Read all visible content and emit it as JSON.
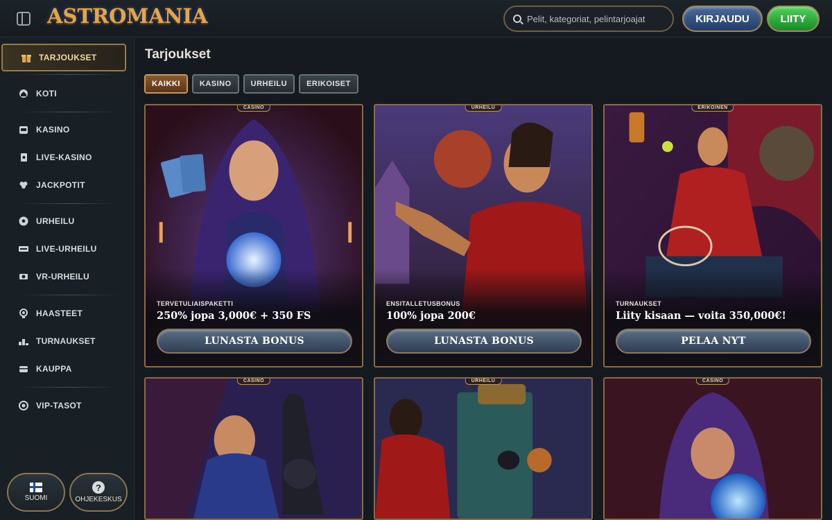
{
  "header": {
    "logo_text": "ASTROMANIA",
    "search_placeholder": "Pelit, kategoriat, pelintarjoajat",
    "login_label": "KIRJAUDU",
    "join_label": "LIITY"
  },
  "sidebar": {
    "items": [
      {
        "label": "TARJOUKSET",
        "icon": "gift-icon"
      },
      {
        "label": "KOTI",
        "icon": "home-icon"
      },
      {
        "label": "KASINO",
        "icon": "slot-machine-icon"
      },
      {
        "label": "LIVE-KASINO",
        "icon": "playing-card-icon"
      },
      {
        "label": "JACKPOTIT",
        "icon": "clover-icon"
      },
      {
        "label": "URHEILU",
        "icon": "soccer-ball-icon"
      },
      {
        "label": "LIVE-URHEILU",
        "icon": "live-badge-icon"
      },
      {
        "label": "VR-URHEILU",
        "icon": "vr-icon"
      },
      {
        "label": "HAASTEET",
        "icon": "medal-icon"
      },
      {
        "label": "TURNAUKSET",
        "icon": "podium-icon"
      },
      {
        "label": "KAUPPA",
        "icon": "chest-icon"
      },
      {
        "label": "VIP-TASOT",
        "icon": "vip-icon"
      }
    ],
    "language_label": "SUOMI",
    "help_label": "OHJEKESKUS",
    "help_glyph": "?"
  },
  "main": {
    "title": "Tarjoukset",
    "filters": [
      "KAIKKI",
      "KASINO",
      "URHEILU",
      "ERIKOISET"
    ],
    "cards": [
      {
        "badge": "CASINO",
        "category": "TERVETULIAISPAKETTI",
        "offer": "250% jopa 3,000€ + 350 FS",
        "cta": "LUNASTA BONUS"
      },
      {
        "badge": "URHEILU",
        "category": "ENSITALLETUSBONUS",
        "offer": "100% jopa 200€",
        "cta": "LUNASTA BONUS"
      },
      {
        "badge": "ERIKOINEN",
        "category": "TURNAUKSET",
        "offer": "Liity kisaan — voita 350,000€!",
        "cta": "PELAA NYT"
      },
      {
        "badge": "CASINO"
      },
      {
        "badge": "URHEILU"
      },
      {
        "badge": "CASINO"
      }
    ]
  },
  "colors": {
    "accent_gold": "#c79a55",
    "join_green": "#2fb23c",
    "login_blue": "#2f4f82"
  }
}
